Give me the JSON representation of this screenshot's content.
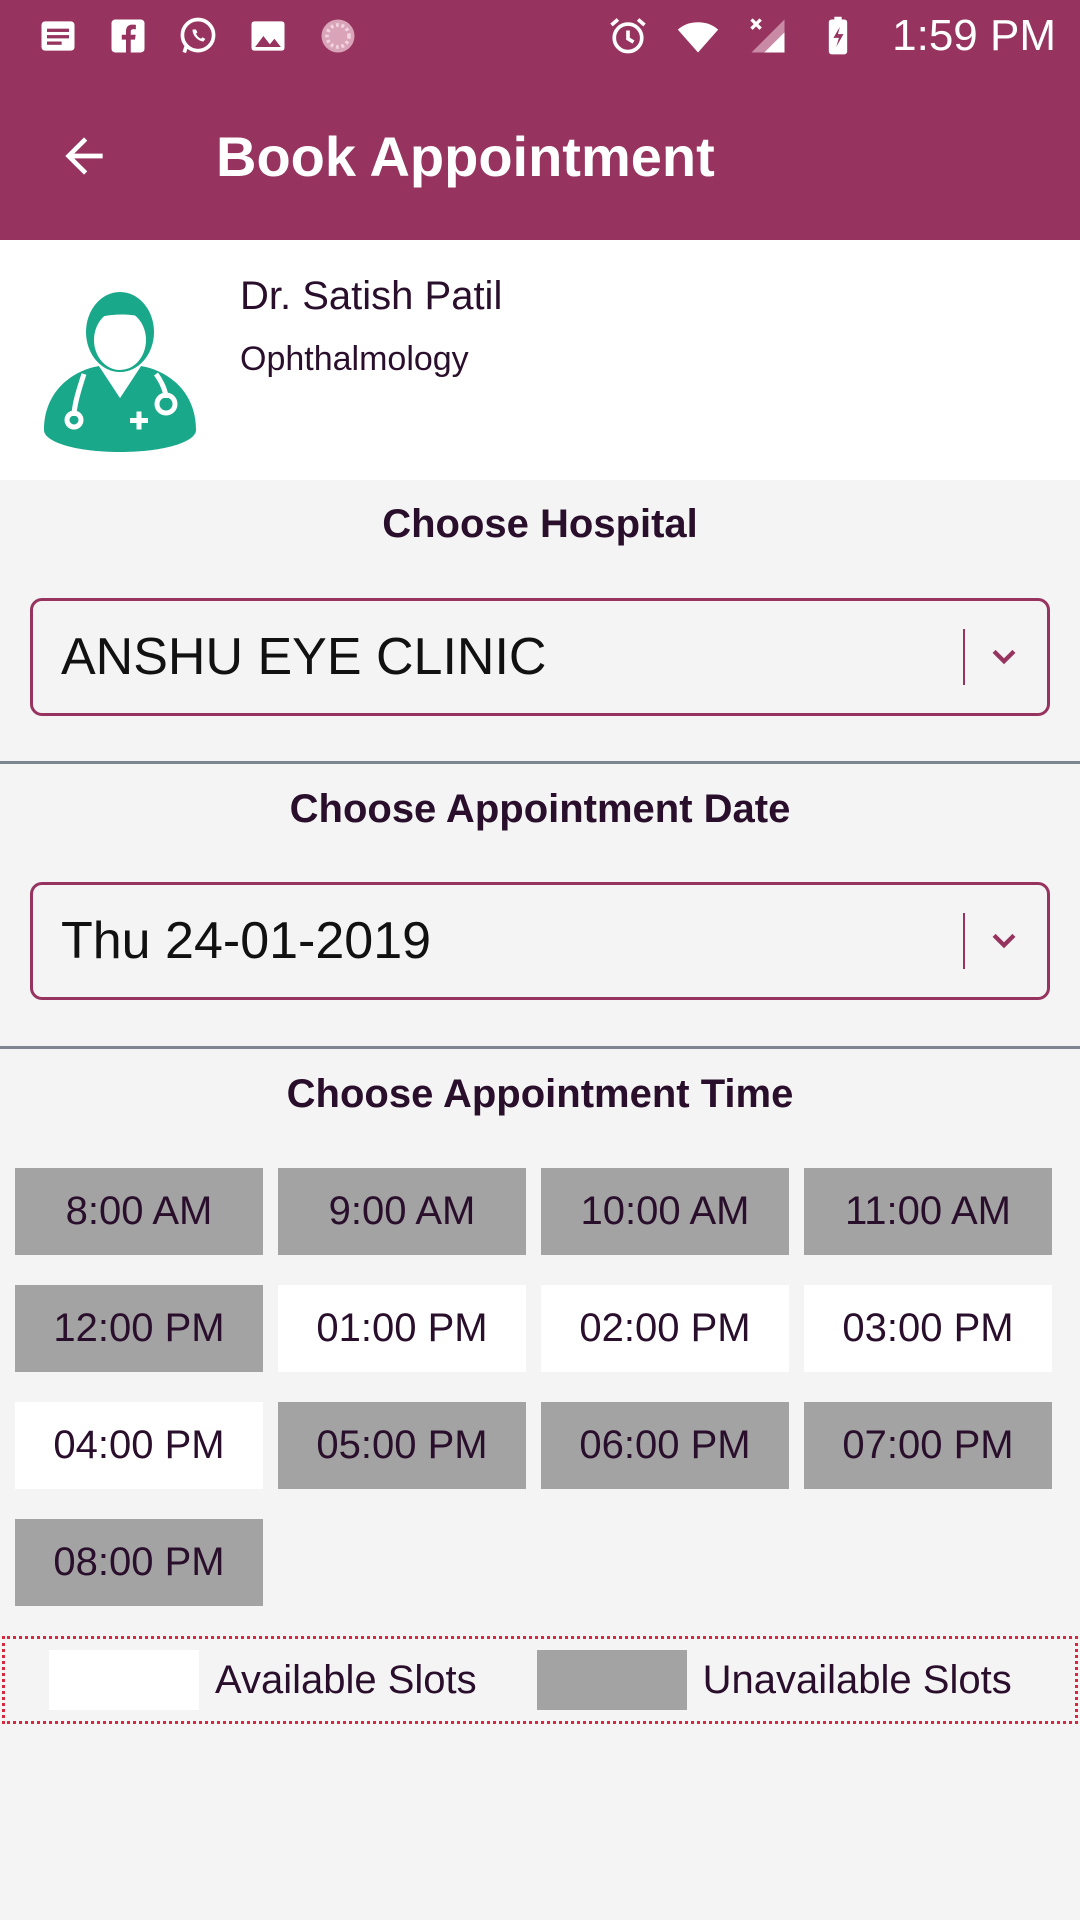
{
  "status_bar": {
    "time": "1:59 PM",
    "left_icons": [
      "notes-icon",
      "facebook-icon",
      "whatsapp-icon",
      "image-icon",
      "loading-icon"
    ],
    "right_icons": [
      "alarm-icon",
      "wifi-icon",
      "signal-icon",
      "battery-icon"
    ]
  },
  "app_bar": {
    "title": "Book Appointment",
    "back_icon": "arrow-back-icon"
  },
  "doctor": {
    "name": "Dr. Satish Patil",
    "specialty": "Ophthalmology",
    "avatar_icon": "doctor-avatar-icon"
  },
  "hospital": {
    "label": "Choose Hospital",
    "selected": "ANSHU EYE CLINIC"
  },
  "date": {
    "label": "Choose Appointment Date",
    "selected": "Thu 24-01-2019"
  },
  "time": {
    "label": "Choose Appointment Time",
    "slots": [
      {
        "label": "8:00 AM",
        "available": false
      },
      {
        "label": "9:00 AM",
        "available": false
      },
      {
        "label": "10:00 AM",
        "available": false
      },
      {
        "label": "11:00 AM",
        "available": false
      },
      {
        "label": "12:00 PM",
        "available": false
      },
      {
        "label": "01:00 PM",
        "available": true
      },
      {
        "label": "02:00 PM",
        "available": true
      },
      {
        "label": "03:00 PM",
        "available": true
      },
      {
        "label": "04:00 PM",
        "available": true
      },
      {
        "label": "05:00 PM",
        "available": false
      },
      {
        "label": "06:00 PM",
        "available": false
      },
      {
        "label": "07:00 PM",
        "available": false
      },
      {
        "label": "08:00 PM",
        "available": false
      }
    ]
  },
  "legend": {
    "available": "Available Slots",
    "unavailable": "Unavailable Slots"
  },
  "colors": {
    "primary": "#96345f",
    "avatar": "#1aa88a",
    "unavailable": "#a3a3a3",
    "available": "#ffffff",
    "legend_border": "#d6283f"
  }
}
